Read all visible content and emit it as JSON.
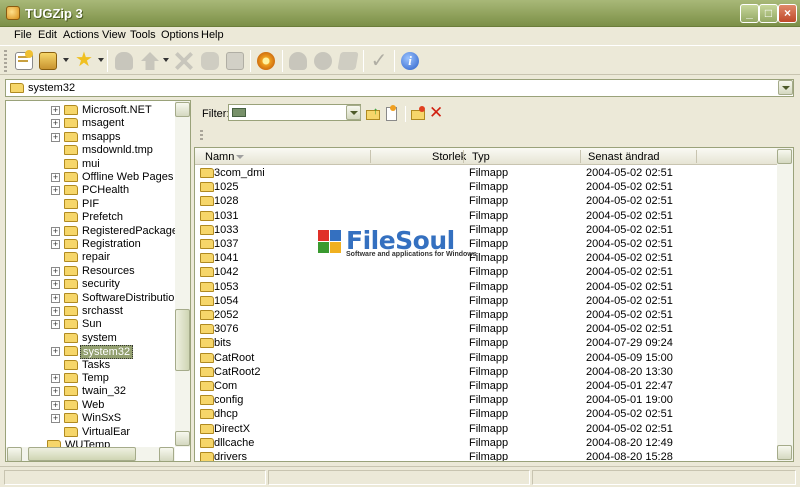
{
  "window": {
    "title": "TUGZip 3"
  },
  "menu": [
    "File",
    "Edit",
    "Actions",
    "View",
    "Tools",
    "Options",
    "Help"
  ],
  "toolbar": {
    "buttons": [
      "new-archive-icon",
      "open-archive-icon",
      "favorites-icon",
      "add-icon",
      "extract-icon",
      "delete-icon",
      "view-icon",
      "find-icon",
      "config-icon",
      "scan-icon",
      "repair-icon",
      "encrypt-icon",
      "test-icon",
      "about-icon"
    ]
  },
  "address": {
    "value": "system32"
  },
  "tree": {
    "items": [
      {
        "label": "Microsoft.NET",
        "expandable": true
      },
      {
        "label": "msagent",
        "expandable": true
      },
      {
        "label": "msapps",
        "expandable": true
      },
      {
        "label": "msdownld.tmp",
        "expandable": false
      },
      {
        "label": "mui",
        "expandable": false
      },
      {
        "label": "Offline Web Pages",
        "expandable": true
      },
      {
        "label": "PCHealth",
        "expandable": true
      },
      {
        "label": "PIF",
        "expandable": false
      },
      {
        "label": "Prefetch",
        "expandable": false
      },
      {
        "label": "RegisteredPackages",
        "expandable": true
      },
      {
        "label": "Registration",
        "expandable": true
      },
      {
        "label": "repair",
        "expandable": false
      },
      {
        "label": "Resources",
        "expandable": true
      },
      {
        "label": "security",
        "expandable": true
      },
      {
        "label": "SoftwareDistribution",
        "expandable": true
      },
      {
        "label": "srchasst",
        "expandable": true
      },
      {
        "label": "Sun",
        "expandable": true
      },
      {
        "label": "system",
        "expandable": false
      },
      {
        "label": "system32",
        "expandable": true,
        "selected": true
      },
      {
        "label": "Tasks",
        "expandable": false
      },
      {
        "label": "Temp",
        "expandable": true
      },
      {
        "label": "twain_32",
        "expandable": true
      },
      {
        "label": "Web",
        "expandable": true
      },
      {
        "label": "WinSxS",
        "expandable": true
      },
      {
        "label": "VirtualEar",
        "expandable": false
      },
      {
        "label": "WUTemp",
        "expandable": false
      }
    ]
  },
  "filter": {
    "label": "Filter:"
  },
  "list": {
    "columns": [
      "Namn",
      "Storlek",
      "Typ",
      "Senast ändrad"
    ],
    "rows": [
      {
        "name": "3com_dmi",
        "size": "",
        "type": "Filmapp",
        "modified": "2004-05-02 02:51"
      },
      {
        "name": "1025",
        "size": "",
        "type": "Filmapp",
        "modified": "2004-05-02 02:51"
      },
      {
        "name": "1028",
        "size": "",
        "type": "Filmapp",
        "modified": "2004-05-02 02:51"
      },
      {
        "name": "1031",
        "size": "",
        "type": "Filmapp",
        "modified": "2004-05-02 02:51"
      },
      {
        "name": "1033",
        "size": "",
        "type": "Filmapp",
        "modified": "2004-05-02 02:51"
      },
      {
        "name": "1037",
        "size": "",
        "type": "Filmapp",
        "modified": "2004-05-02 02:51"
      },
      {
        "name": "1041",
        "size": "",
        "type": "Filmapp",
        "modified": "2004-05-02 02:51"
      },
      {
        "name": "1042",
        "size": "",
        "type": "Filmapp",
        "modified": "2004-05-02 02:51"
      },
      {
        "name": "1053",
        "size": "",
        "type": "Filmapp",
        "modified": "2004-05-02 02:51"
      },
      {
        "name": "1054",
        "size": "",
        "type": "Filmapp",
        "modified": "2004-05-02 02:51"
      },
      {
        "name": "2052",
        "size": "",
        "type": "Filmapp",
        "modified": "2004-05-02 02:51"
      },
      {
        "name": "3076",
        "size": "",
        "type": "Filmapp",
        "modified": "2004-05-02 02:51"
      },
      {
        "name": "bits",
        "size": "",
        "type": "Filmapp",
        "modified": "2004-07-29 09:24"
      },
      {
        "name": "CatRoot",
        "size": "",
        "type": "Filmapp",
        "modified": "2004-05-09 15:00"
      },
      {
        "name": "CatRoot2",
        "size": "",
        "type": "Filmapp",
        "modified": "2004-08-20 13:30"
      },
      {
        "name": "Com",
        "size": "",
        "type": "Filmapp",
        "modified": "2004-05-01 22:47"
      },
      {
        "name": "config",
        "size": "",
        "type": "Filmapp",
        "modified": "2004-05-01 19:00"
      },
      {
        "name": "dhcp",
        "size": "",
        "type": "Filmapp",
        "modified": "2004-05-02 02:51"
      },
      {
        "name": "DirectX",
        "size": "",
        "type": "Filmapp",
        "modified": "2004-05-02 02:51"
      },
      {
        "name": "dllcache",
        "size": "",
        "type": "Filmapp",
        "modified": "2004-08-20 12:49"
      },
      {
        "name": "drivers",
        "size": "",
        "type": "Filmapp",
        "modified": "2004-08-20 15:28"
      }
    ]
  },
  "watermark": {
    "brand": "FileSoul",
    "tagline": "Software and applications for Windows"
  },
  "colors": {
    "title_bar": "#8ea05a",
    "selection": "#93a070",
    "folder": "#f6d66a",
    "watermark": "#3470c0"
  }
}
